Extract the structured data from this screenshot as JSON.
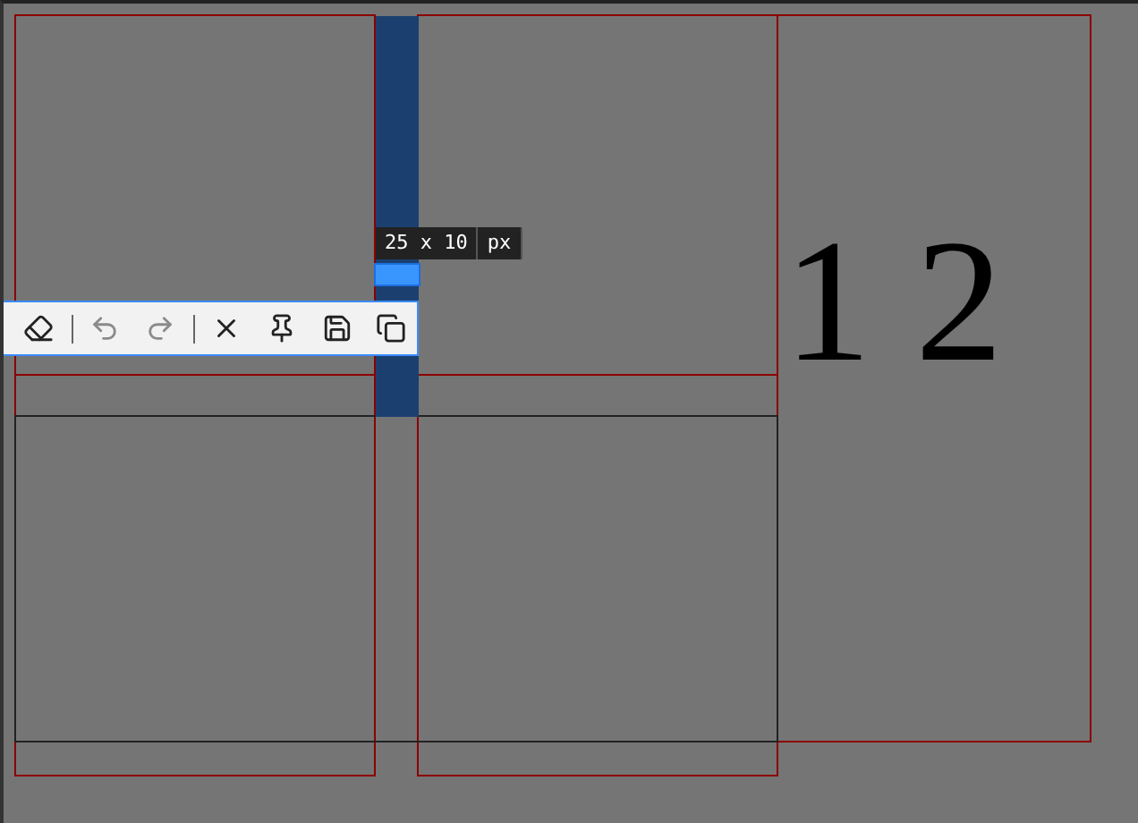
{
  "canvas": {
    "text": "1 2"
  },
  "size_tip": {
    "size": "25 x 10",
    "unit": "px"
  },
  "toolbar": [
    {
      "kind": "eraser",
      "disabled": false
    },
    {
      "kind": "divider"
    },
    {
      "kind": "undo",
      "disabled": true
    },
    {
      "kind": "redo",
      "disabled": true
    },
    {
      "kind": "divider"
    },
    {
      "kind": "close",
      "disabled": false
    },
    {
      "kind": "pin",
      "disabled": false
    },
    {
      "kind": "save",
      "disabled": false
    },
    {
      "kind": "copy",
      "disabled": false
    }
  ]
}
